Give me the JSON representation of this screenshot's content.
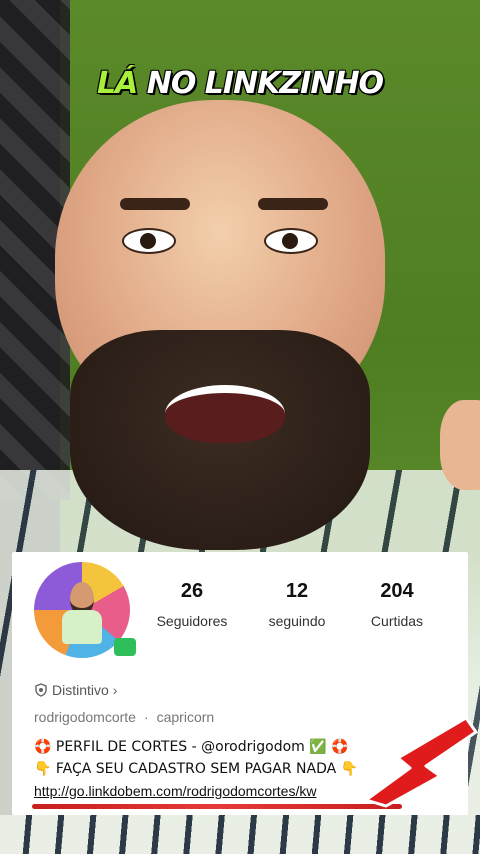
{
  "caption": {
    "highlight": "LÁ",
    "rest": "NO LINKZINHO"
  },
  "profile": {
    "stats": [
      {
        "value": "26",
        "label": "Seguidores"
      },
      {
        "value": "12",
        "label": "seguindo"
      },
      {
        "value": "204",
        "label": "Curtidas"
      }
    ],
    "badge_label": "Distintivo",
    "badge_chevron": "›",
    "username": "rodrigodomcorte",
    "separator": "·",
    "sign": "capricorn",
    "bio_line1": "🛟 PERFIL DE CORTES - @orodrigodom ✅ 🛟",
    "bio_line2": "👇 FAÇA SEU CADASTRO SEM PAGAR NADA 👇",
    "bio_link": "http://go.linkdobem.com/rodrigodomcortes/kw"
  },
  "colors": {
    "caption_highlight": "#a8f03a",
    "arrow": "#e01b1b",
    "underline": "#d32020"
  },
  "icons": {
    "badge": "shield-badge-icon",
    "arrow": "red-arrow-icon"
  }
}
